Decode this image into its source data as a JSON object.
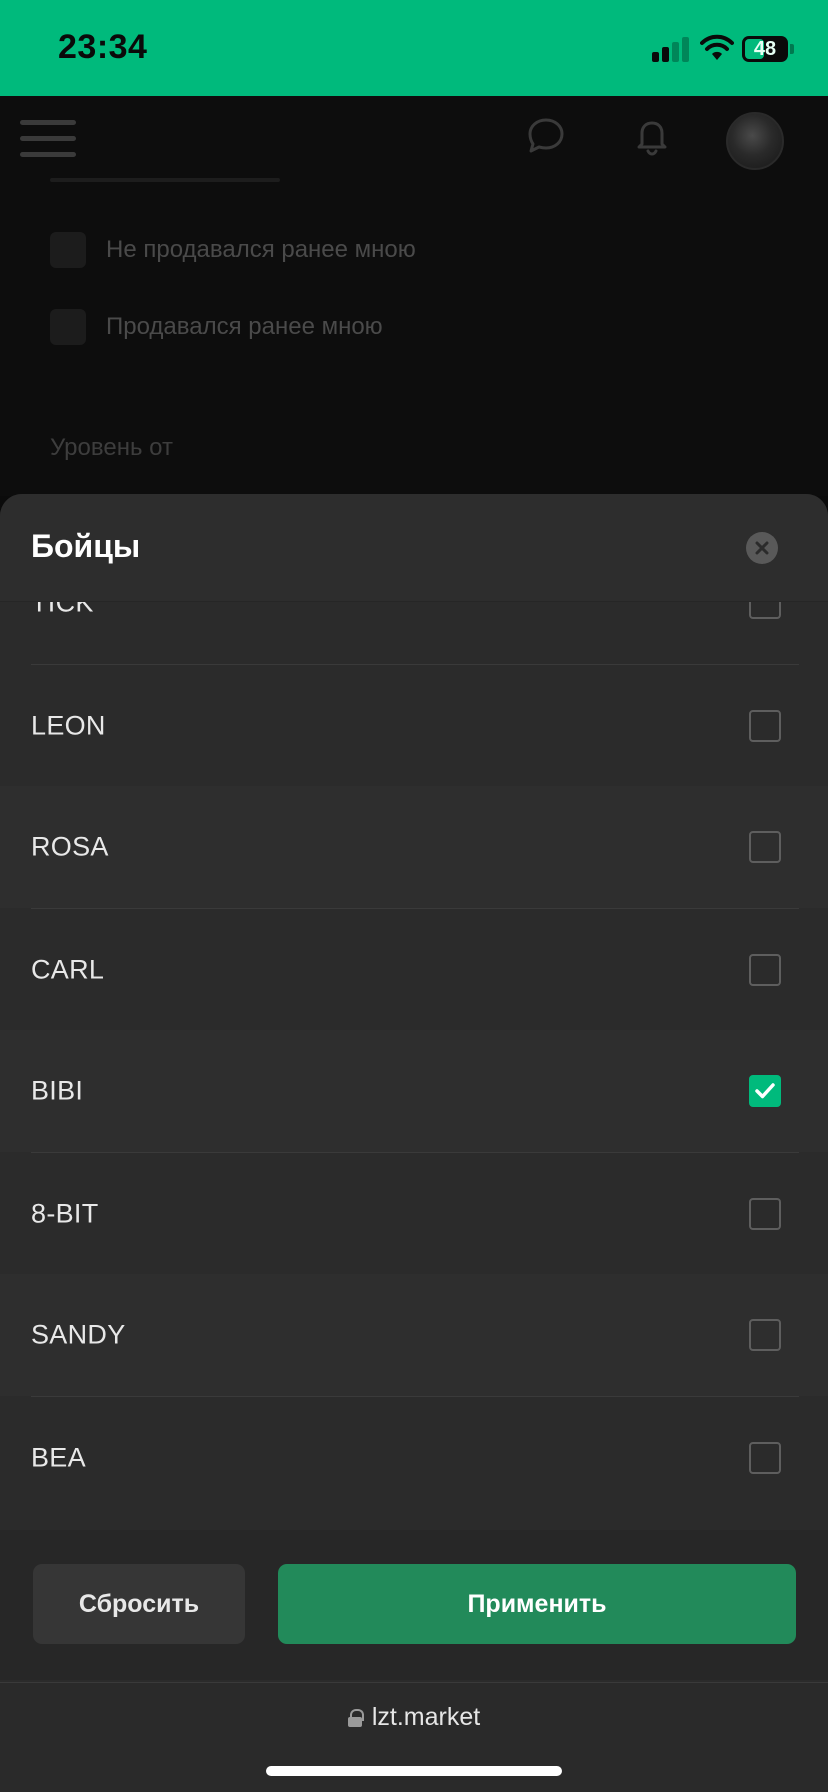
{
  "status_bar": {
    "time": "23:34",
    "battery_level": "48",
    "battery_fraction": 0.48,
    "accent_color": "#00ba7c"
  },
  "background_page": {
    "icons": [
      "menu-icon",
      "chat-icon",
      "bell-icon",
      "avatar"
    ],
    "options": [
      {
        "label": "Не продавался ранее мною"
      },
      {
        "label": "Продавался ранее мною"
      }
    ],
    "level_label": "Уровень от"
  },
  "sheet": {
    "title": "Бойцы",
    "close_icon": "close-icon",
    "items": [
      {
        "label": "TICK",
        "checked": false
      },
      {
        "label": "LEON",
        "checked": false
      },
      {
        "label": "ROSA",
        "checked": false
      },
      {
        "label": "CARL",
        "checked": false
      },
      {
        "label": "BIBI",
        "checked": true
      },
      {
        "label": "8-BIT",
        "checked": false
      },
      {
        "label": "SANDY",
        "checked": false
      },
      {
        "label": "BEA",
        "checked": false
      }
    ],
    "reset_label": "Сбросить",
    "apply_label": "Применить",
    "apply_color": "#228a5a"
  },
  "browser": {
    "url": "lzt.market",
    "lock_icon": "lock-icon"
  }
}
